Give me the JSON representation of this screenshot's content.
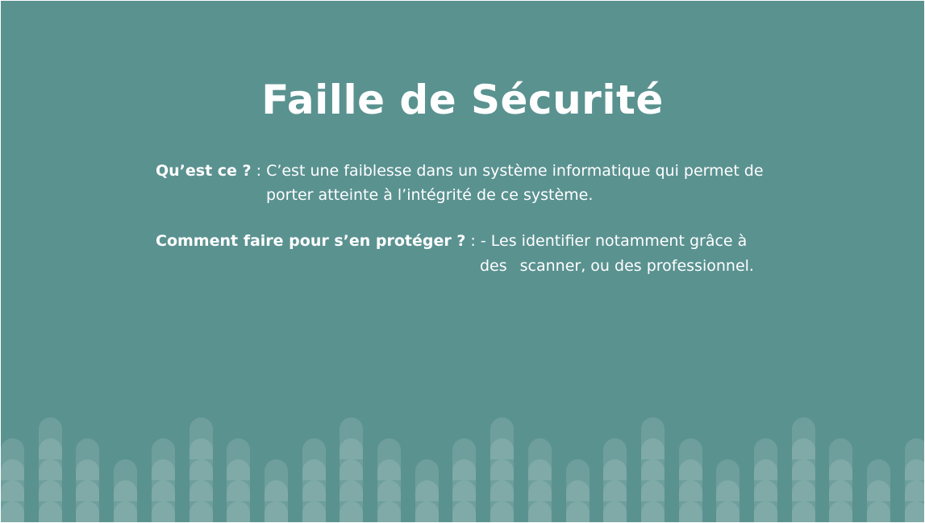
{
  "slide": {
    "title": "Faille de Sécurité",
    "items": [
      {
        "question": "Qu’est ce ?",
        "separator": " : ",
        "answer_line1": "C’est une faiblesse dans un système informatique qui permet de",
        "answer_line2": "porter atteinte à l’intégrité de ce système."
      },
      {
        "question": "Comment faire pour s’en protéger ?",
        "separator": " : - ",
        "answer_line1": "Les identifier notamment grâce à",
        "answer_line2a": "des",
        "answer_line2b": "scanner, ou des professionnel."
      }
    ]
  },
  "colors": {
    "background": "#5a9290",
    "text": "#ffffff"
  },
  "decoration": {
    "name": "rounded-bar-pattern"
  }
}
